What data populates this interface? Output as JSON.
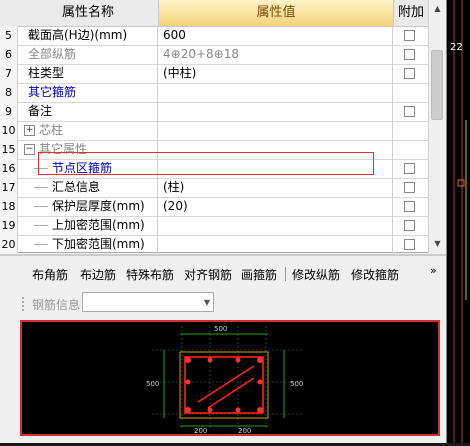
{
  "grid": {
    "header": {
      "name": "属性名称",
      "value": "属性值",
      "add": "附加"
    },
    "rows": [
      {
        "idx": "5",
        "name": "截面高(H边)(mm)",
        "value": "600",
        "style": "normal",
        "checkbox": true
      },
      {
        "idx": "6",
        "name": "全部纵筋",
        "value": "4⊕20+8⊕18",
        "style": "gray",
        "checkbox": true
      },
      {
        "idx": "7",
        "name": "柱类型",
        "value": "(中柱)",
        "style": "normal",
        "checkbox": true
      },
      {
        "idx": "8",
        "name": "其它箍筋",
        "value": "",
        "style": "blue",
        "checkbox": false
      },
      {
        "idx": "9",
        "name": "备注",
        "value": "",
        "style": "normal",
        "checkbox": true
      },
      {
        "idx": "10",
        "name": "芯柱",
        "value": "",
        "style": "expand-plus",
        "checkbox": false
      },
      {
        "idx": "15",
        "name": "其它属性",
        "value": "",
        "style": "expand-minus",
        "checkbox": false
      },
      {
        "idx": "16",
        "name": "节点区箍筋",
        "value": "",
        "style": "child-blue",
        "checkbox": true
      },
      {
        "idx": "17",
        "name": "汇总信息",
        "value": "(柱)",
        "style": "child",
        "checkbox": true
      },
      {
        "idx": "18",
        "name": "保护层厚度(mm)",
        "value": "(20)",
        "style": "child",
        "checkbox": true
      },
      {
        "idx": "19",
        "name": "上加密范围(mm)",
        "value": "",
        "style": "child",
        "checkbox": true
      },
      {
        "idx": "20",
        "name": "下加密范围(mm)",
        "value": "",
        "style": "child",
        "checkbox": true
      }
    ]
  },
  "toolbar": {
    "corner": "布角筋",
    "edge": "布边筋",
    "special": "特殊布筋",
    "align": "对齐钢筋",
    "draw_stirrup": "画箍筋",
    "edit_long": "修改纵筋",
    "edit_stirrup": "修改箍筋"
  },
  "rebar_info": {
    "label": "钢筋信息",
    "value": ""
  },
  "drawing": {
    "dim_top": "500",
    "dim_left": "500",
    "dim_right": "500",
    "dim_bottom_left": "200",
    "dim_bottom_right": "200"
  },
  "colors": {
    "header_value_bg": "#f4d27a",
    "highlight_border": "#e03030",
    "drawing_frame": "#d03030",
    "rebar": "#ff2020",
    "dimension": "#33cc33"
  }
}
